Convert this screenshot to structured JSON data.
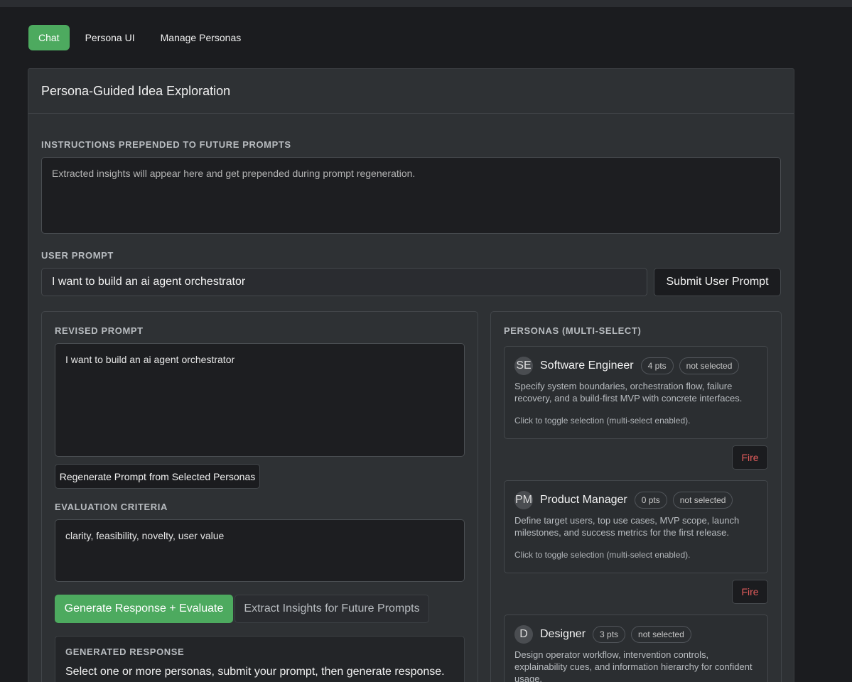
{
  "nav": {
    "tabs": [
      {
        "label": "Chat",
        "active": true
      },
      {
        "label": "Persona UI",
        "active": false
      },
      {
        "label": "Manage Personas",
        "active": false
      }
    ]
  },
  "panel": {
    "title": "Persona-Guided Idea Exploration"
  },
  "instructions": {
    "label": "Instructions prepended to future prompts",
    "placeholder": "Extracted insights will appear here and get prepended during prompt regeneration."
  },
  "user_prompt": {
    "label": "User Prompt",
    "value": "I want to build an ai agent orchestrator",
    "submit_label": "Submit User Prompt"
  },
  "revised_prompt": {
    "label": "Revised Prompt",
    "value": "I want to build an ai agent orchestrator",
    "regenerate_label": "Regenerate Prompt from Selected Personas"
  },
  "evaluation": {
    "label": "Evaluation Criteria",
    "value": "clarity, feasibility, novelty, user value"
  },
  "actions": {
    "generate_label": "Generate Response + Evaluate",
    "extract_label": "Extract Insights for Future Prompts"
  },
  "generated": {
    "label": "Generated Response",
    "text": "Select one or more personas, submit your prompt, then generate response."
  },
  "personas": {
    "label": "Personas (multi-select)",
    "fire_label": "Fire",
    "hint": "Click to toggle selection (multi-select enabled).",
    "items": [
      {
        "initials": "SE",
        "name": "Software Engineer",
        "points": "4 pts",
        "status": "not selected",
        "description": "Specify system boundaries, orchestration flow, failure recovery, and a build-first MVP with concrete interfaces."
      },
      {
        "initials": "PM",
        "name": "Product Manager",
        "points": "0 pts",
        "status": "not selected",
        "description": "Define target users, top use cases, MVP scope, launch milestones, and success metrics for the first release."
      },
      {
        "initials": "D",
        "name": "Designer",
        "points": "3 pts",
        "status": "not selected",
        "description": "Design operator workflow, intervention controls, explainability cues, and information hierarchy for confident usage."
      }
    ]
  },
  "colors": {
    "accent": "#4daa5f",
    "fire": "#e25c5c",
    "background": "#1b1c1f",
    "panel": "#2e3134"
  }
}
